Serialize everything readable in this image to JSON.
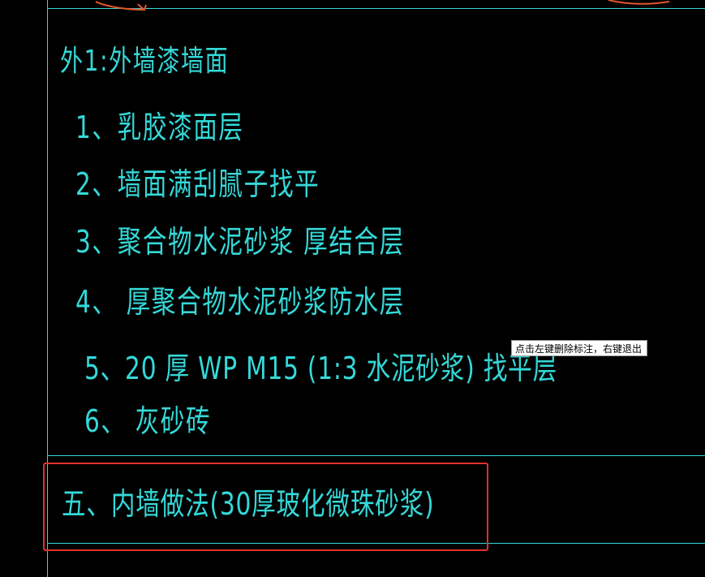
{
  "drawing": {
    "title": "外1:外墙漆墙面",
    "layers": [
      {
        "label": "1、乳胶漆面层"
      },
      {
        "label": "2、墙面满刮腻子找平"
      },
      {
        "label": "3、聚合物水泥砂浆   厚结合层"
      },
      {
        "label": "4、  厚聚合物水泥砂浆防水层"
      },
      {
        "label": "5、20 厚   WP M15  (1:3  水泥砂浆) 找平层"
      },
      {
        "label": "6、 灰砂砖"
      }
    ],
    "section_heading": "五、内墙做法(30厚玻化微珠砂浆)"
  },
  "prompt": {
    "text": "点击左键删除标注，右键退出"
  },
  "colors": {
    "background": "#000000",
    "cad_text": "#35d8d8",
    "annotation_box": "#e0322b",
    "prompt_background": "#ffffff"
  }
}
